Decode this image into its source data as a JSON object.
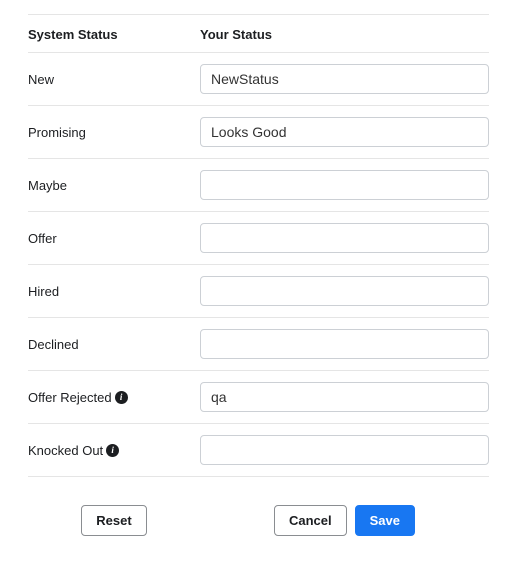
{
  "headers": {
    "system_status": "System Status",
    "your_status": "Your Status"
  },
  "rows": [
    {
      "label": "New",
      "value": "NewStatus",
      "info": false,
      "name": "new"
    },
    {
      "label": "Promising",
      "value": "Looks Good",
      "info": false,
      "name": "promising"
    },
    {
      "label": "Maybe",
      "value": "",
      "info": false,
      "name": "maybe"
    },
    {
      "label": "Offer",
      "value": "",
      "info": false,
      "name": "offer"
    },
    {
      "label": "Hired",
      "value": "",
      "info": false,
      "name": "hired"
    },
    {
      "label": "Declined",
      "value": "",
      "info": false,
      "name": "declined"
    },
    {
      "label": "Offer Rejected",
      "value": "qa",
      "info": true,
      "name": "offer-rejected"
    },
    {
      "label": "Knocked Out",
      "value": "",
      "info": true,
      "name": "knocked-out"
    }
  ],
  "buttons": {
    "reset": "Reset",
    "cancel": "Cancel",
    "save": "Save"
  }
}
